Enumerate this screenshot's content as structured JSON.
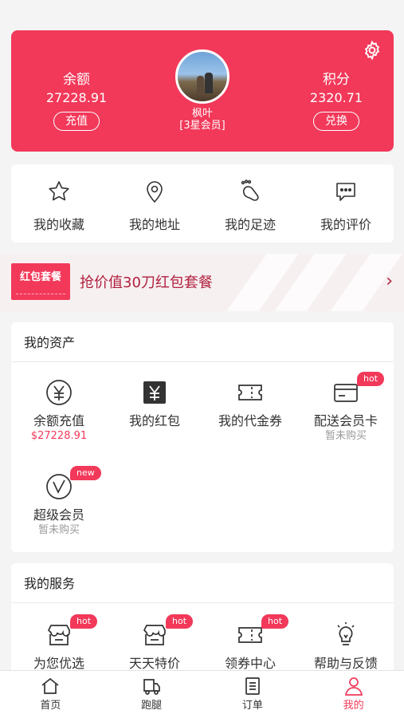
{
  "colors": {
    "accent": "#f2395a",
    "background": "#f4f4f4"
  },
  "header": {
    "balance_label": "余额",
    "balance_value": "27228.91",
    "recharge_button": "充值",
    "points_label": "积分",
    "points_value": "2320.71",
    "exchange_button": "兑换",
    "user_name": "枫叶",
    "member_level": "[3星会员]",
    "settings_icon": "gear-icon"
  },
  "quick_links": [
    {
      "label": "我的收藏",
      "icon": "star-icon"
    },
    {
      "label": "我的地址",
      "icon": "location-pin-icon"
    },
    {
      "label": "我的足迹",
      "icon": "footprint-icon"
    },
    {
      "label": "我的评价",
      "icon": "comment-icon"
    }
  ],
  "promo": {
    "tag": "红包套餐",
    "text": "抢价值30刀红包套餐",
    "arrow": "›"
  },
  "assets": {
    "title": "我的资产",
    "items": [
      {
        "label": "余额充值",
        "sub": "$27228.91",
        "icon": "yen-circle-icon"
      },
      {
        "label": "我的红包",
        "sub": "",
        "icon": "red-packet-icon"
      },
      {
        "label": "我的代金券",
        "sub": "",
        "icon": "voucher-icon"
      },
      {
        "label": "配送会员卡",
        "sub": "暂未购买",
        "badge": "hot",
        "icon": "card-icon"
      },
      {
        "label": "超级会员",
        "sub": "暂未购买",
        "badge": "new",
        "icon": "super-member-icon"
      }
    ]
  },
  "services": {
    "title": "我的服务",
    "items": [
      {
        "label": "为您优选",
        "badge": "hot",
        "icon": "shop-icon"
      },
      {
        "label": "天天特价",
        "badge": "hot",
        "icon": "shop-sale-icon"
      },
      {
        "label": "领券中心",
        "badge": "hot",
        "icon": "coupon-icon"
      },
      {
        "label": "帮助与反馈",
        "icon": "lightbulb-icon"
      }
    ]
  },
  "tabbar": [
    {
      "label": "首页",
      "icon": "home-icon"
    },
    {
      "label": "跑腿",
      "icon": "truck-icon"
    },
    {
      "label": "订单",
      "icon": "order-list-icon"
    },
    {
      "label": "我的",
      "icon": "person-icon",
      "active": true
    }
  ]
}
